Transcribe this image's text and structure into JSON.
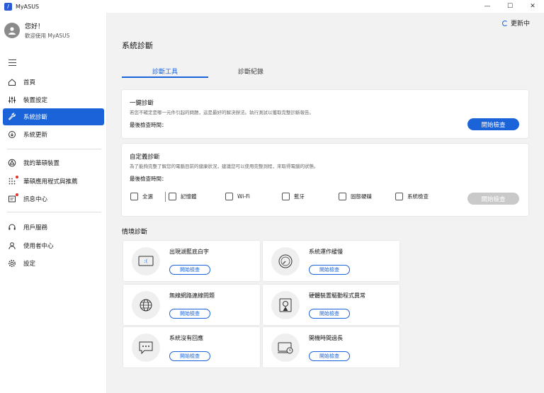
{
  "window": {
    "logo_text": "/",
    "title": "MyASUS",
    "minimize": "—",
    "maximize": "☐",
    "close": "✕"
  },
  "profile": {
    "greeting": "您好！",
    "welcome": "歡迎使用 MyASUS"
  },
  "sidebar": {
    "items": [
      {
        "label": "首頁",
        "icon": "home-icon"
      },
      {
        "label": "裝置設定",
        "icon": "sliders-icon"
      },
      {
        "label": "系統診斷",
        "icon": "wrench-icon",
        "active": true
      },
      {
        "label": "系統更新",
        "icon": "update-icon"
      },
      {
        "label": "我的華碩裝置",
        "icon": "device-link-icon"
      },
      {
        "label": "華碩應用程式與推薦",
        "icon": "apps-grid-icon",
        "badge": true
      },
      {
        "label": "訊息中心",
        "icon": "message-icon",
        "badge": true
      },
      {
        "label": "用戶服務",
        "icon": "headset-icon"
      },
      {
        "label": "使用者中心",
        "icon": "user-icon"
      },
      {
        "label": "設定",
        "icon": "gear-icon"
      }
    ]
  },
  "header": {
    "update_status": "更新中",
    "page_title": "系統診斷"
  },
  "tabs": [
    {
      "label": "診斷工具",
      "active": true
    },
    {
      "label": "診斷紀錄",
      "active": false
    }
  ],
  "one_click": {
    "title": "一鍵診斷",
    "description": "若您不確定是哪一元件引起的問題，這是最好的解決辦法。執行測試以獲取完整診斷報告。",
    "last_check": "最後檢查時間：",
    "button": "開始檢查"
  },
  "custom": {
    "title": "自定義診斷",
    "description": "為了能夠完整了解您的電腦目前的健康狀況，建議您可以使用完整測程，來取得電腦的狀態。",
    "last_check": "最後檢查時間：",
    "button": "開始檢查",
    "options": [
      "全選",
      "記憶體",
      "Wi-Fi",
      "藍牙",
      "固態硬碟",
      "系統檢查"
    ]
  },
  "scenarios": {
    "title": "情境診斷",
    "button": "開始檢查",
    "items": [
      {
        "title": "出現湖藍底白字",
        "icon": "blue-screen-icon"
      },
      {
        "title": "系統運作緩慢",
        "icon": "speedometer-icon"
      },
      {
        "title": "無線網路連線問題",
        "icon": "globe-icon"
      },
      {
        "title": "硬體裝置驅動程式異常",
        "icon": "driver-warning-icon"
      },
      {
        "title": "系統沒有回應",
        "icon": "chat-dots-icon"
      },
      {
        "title": "開機時間過長",
        "icon": "laptop-clock-icon"
      }
    ]
  },
  "colors": {
    "accent": "#1a63d8",
    "badge": "#e0332b",
    "background": "#f2f2f2"
  }
}
